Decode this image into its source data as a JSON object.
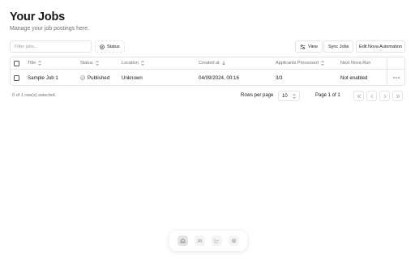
{
  "header": {
    "title": "Your Jobs",
    "subtitle": "Manage your job postings here."
  },
  "toolbar": {
    "filter_placeholder": "Filter jobs...",
    "status_button": "Status",
    "view_button": "View",
    "sync_button": "Sync Jobs",
    "edit_automation_button": "Edit Nova Automation"
  },
  "table": {
    "columns": [
      "Title",
      "Status",
      "Location",
      "Created at",
      "Applicants Processed",
      "Next Nova Run"
    ],
    "rows": [
      {
        "title": "Sample Job 1",
        "status": "Published",
        "location": "Unknown",
        "created_at": "04/09/2024, 00:16",
        "applicants_processed": "3/3",
        "next_nova_run": "Not enabled"
      }
    ]
  },
  "pagination": {
    "selection_text": "0 of 1 row(s) selected.",
    "rows_per_page_label": "Rows per page",
    "rows_per_page_value": "10",
    "page_text": "Page 1 of 1"
  },
  "dock": {
    "items": [
      "home-icon",
      "users-icon",
      "chart-icon",
      "settings-icon"
    ]
  },
  "colors": {
    "text": "#18181b",
    "muted": "#71717a",
    "border": "#e4e4e7"
  }
}
